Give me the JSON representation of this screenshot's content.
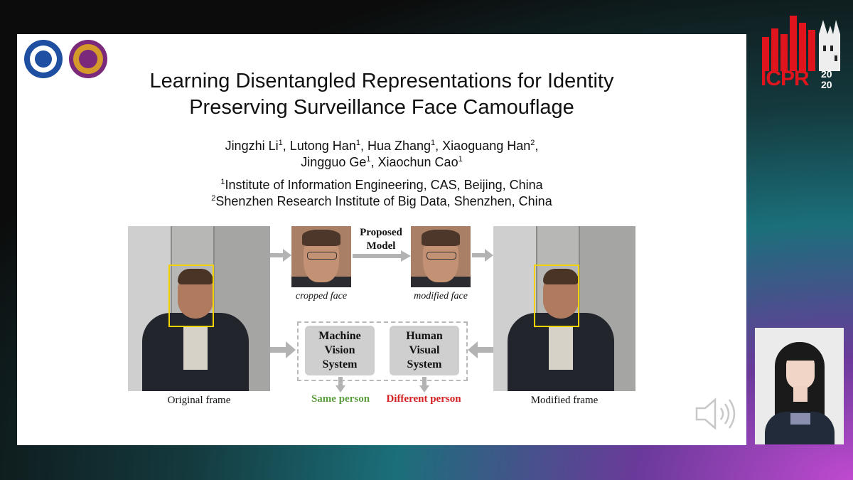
{
  "slide": {
    "title_line1": "Learning Disentangled Representations for Identity",
    "title_line2": "Preserving Surveillance Face Camouflage",
    "authors": [
      {
        "name": "Jingzhi Li",
        "aff": "1",
        "sep": ", "
      },
      {
        "name": "Lutong Han",
        "aff": "1",
        "sep": ", "
      },
      {
        "name": "Hua Zhang",
        "aff": "1",
        "sep": ", "
      },
      {
        "name": "Xiaoguang Han",
        "aff": "2",
        "sep": ","
      },
      {
        "name": "Jingguo Ge",
        "aff": "1",
        "sep": ", "
      },
      {
        "name": "Xiaochun Cao",
        "aff": "1",
        "sep": ""
      }
    ],
    "affiliations": [
      {
        "mark": "1",
        "text": "Institute of Information Engineering, CAS, Beijing, China"
      },
      {
        "mark": "2",
        "text": "Shenzhen Research Institute of Big Data, Shenzhen, China"
      }
    ]
  },
  "figure": {
    "original_caption": "Original frame",
    "modified_caption": "Modified  frame",
    "cropped_caption": "cropped face",
    "modified_face_caption": "modified face",
    "model_label_line1": "Proposed",
    "model_label_line2": "Model",
    "machine_box": [
      "Machine",
      "Vision",
      "System"
    ],
    "human_box": [
      "Human",
      "Visual",
      "System"
    ],
    "same_person": "Same person",
    "different_person": "Different person",
    "colors": {
      "same": "#5a9e3e",
      "different": "#d21f1f",
      "bbox": "#f2d300",
      "arrow": "#b3b3b3"
    }
  },
  "overlay": {
    "conference_logo": "ICPR2020",
    "conference_logo_parts": {
      "main": "ICPR",
      "year_top": "20",
      "year_bottom": "20"
    },
    "brand_color": "#e0141c",
    "speaker_icon": "speaker-volume-icon"
  }
}
